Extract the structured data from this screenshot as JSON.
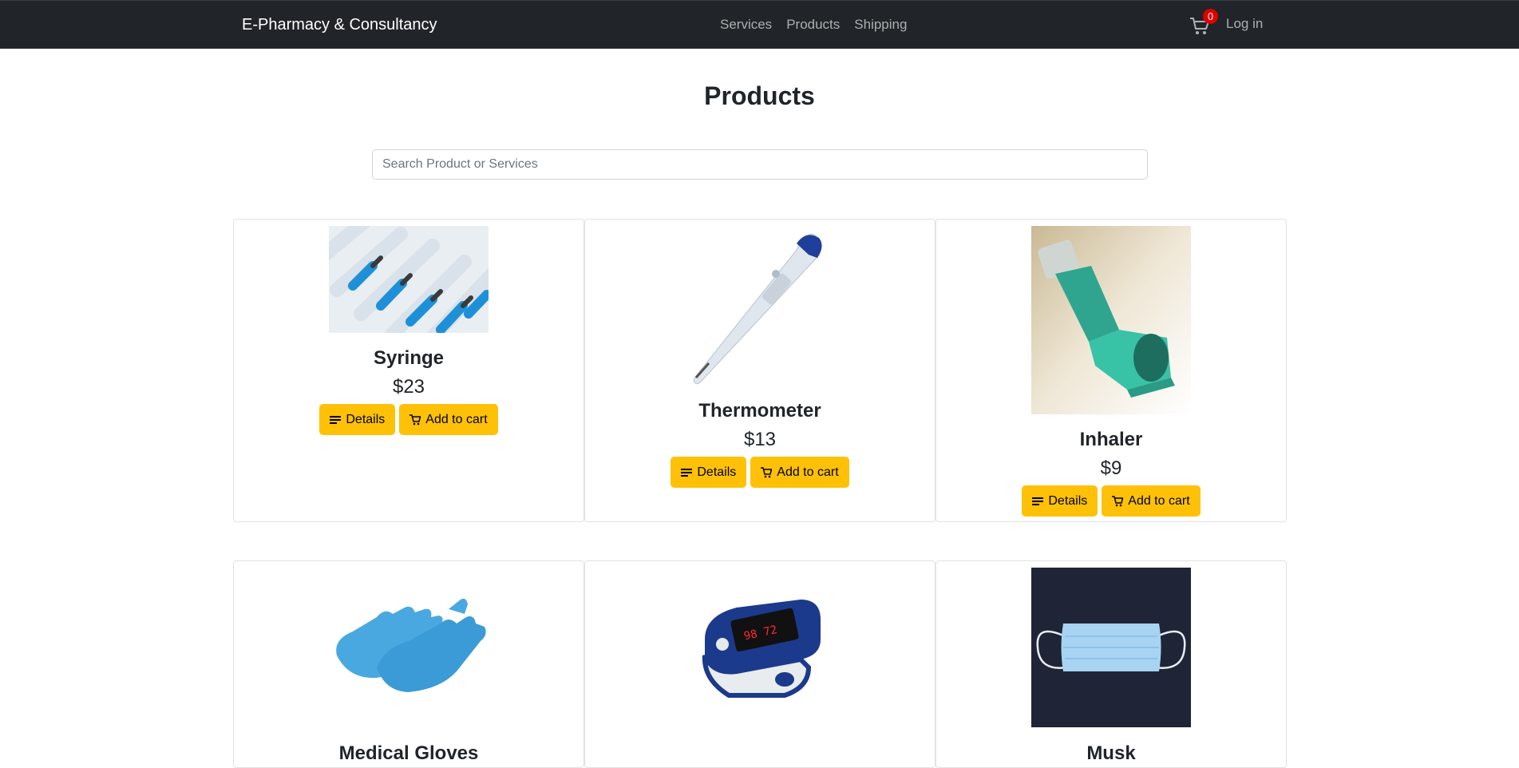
{
  "navbar": {
    "brand": "E-Pharmacy & Consultancy",
    "links": [
      "Services",
      "Products",
      "Shipping"
    ],
    "cart_count": "0",
    "login": "Log in"
  },
  "main": {
    "title": "Products",
    "search_placeholder": "Search Product or Services"
  },
  "products": [
    {
      "name": "Syringe",
      "price": "$23",
      "details_label": "Details",
      "cart_label": "Add to cart"
    },
    {
      "name": "Thermometer",
      "price": "$13",
      "details_label": "Details",
      "cart_label": "Add to cart"
    },
    {
      "name": "Inhaler",
      "price": "$9",
      "details_label": "Details",
      "cart_label": "Add to cart"
    },
    {
      "name": "Medical Gloves",
      "price": "",
      "details_label": "",
      "cart_label": ""
    },
    {
      "name": "",
      "price": "",
      "details_label": "",
      "cart_label": ""
    },
    {
      "name": "Musk",
      "price": "",
      "details_label": "",
      "cart_label": ""
    }
  ],
  "colors": {
    "navbar": "#212529",
    "button": "#ffc107",
    "badge": "#e00000"
  }
}
